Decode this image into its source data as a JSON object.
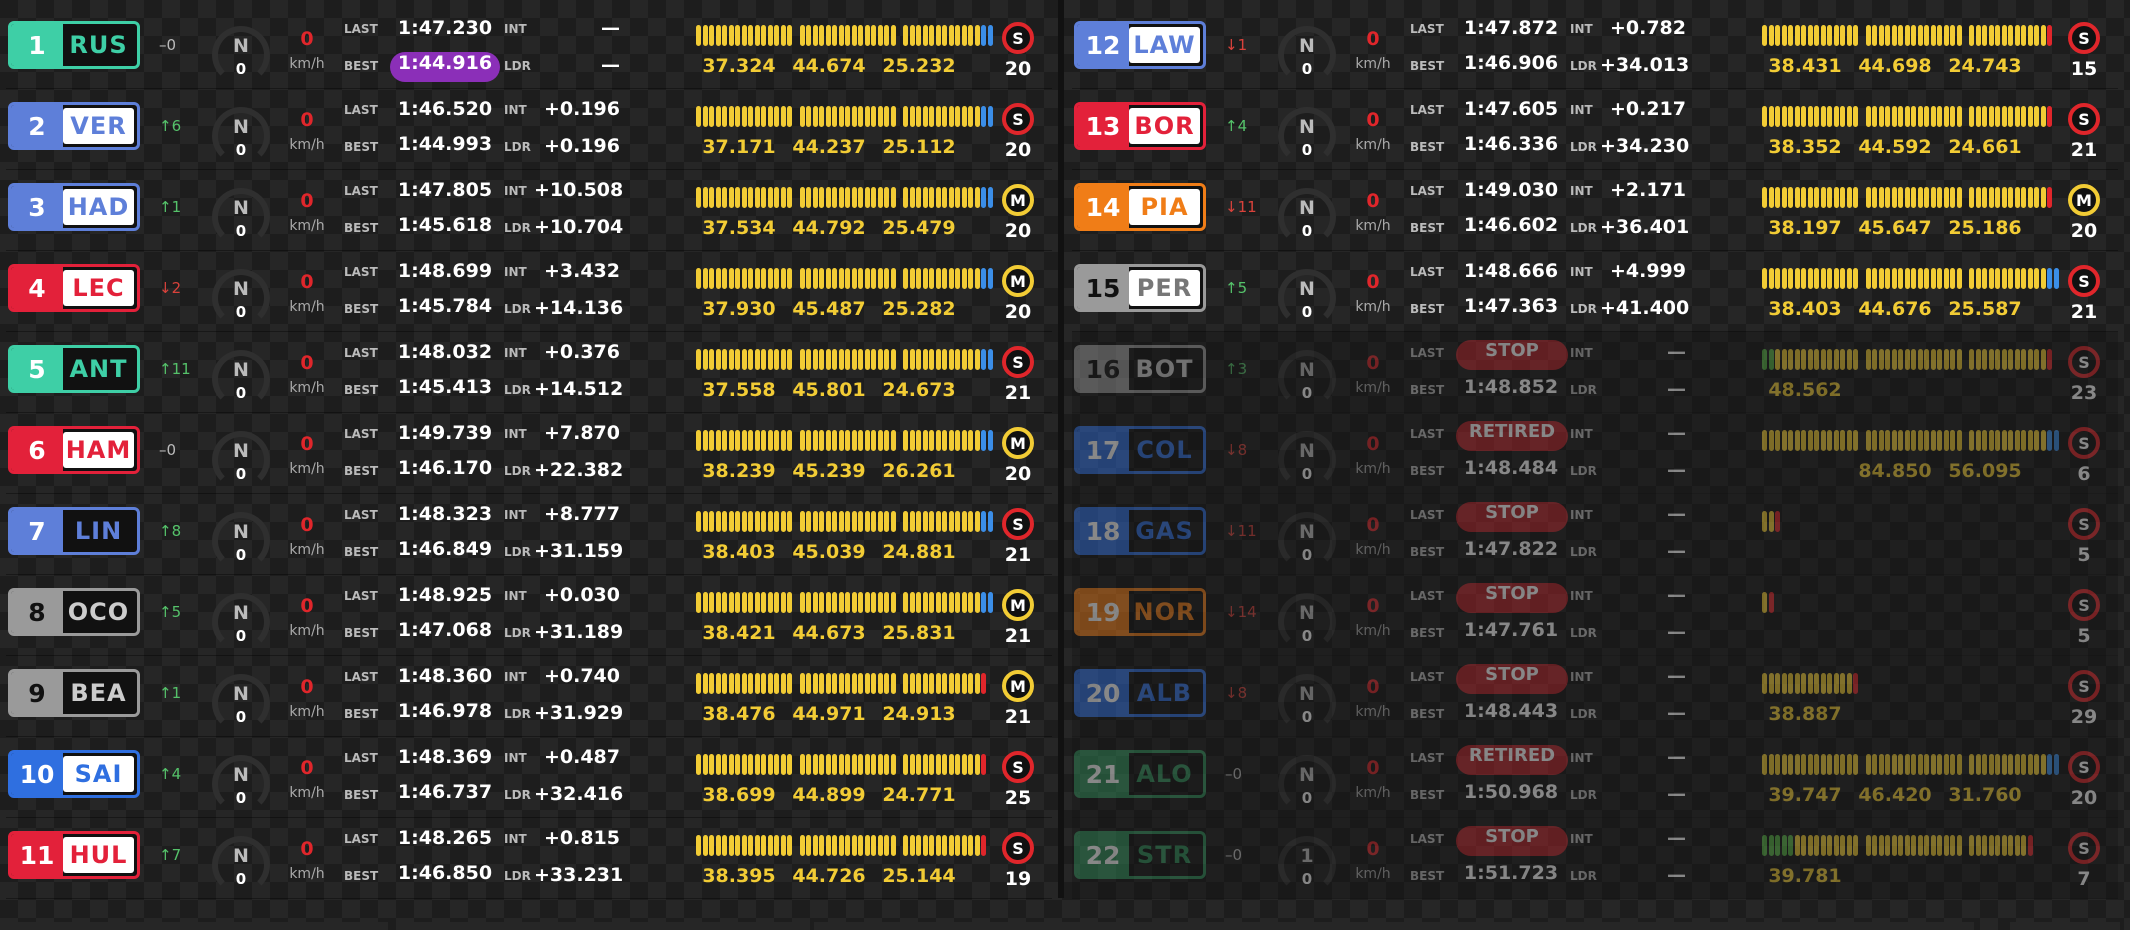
{
  "labels": {
    "last": "LAST",
    "best": "BEST",
    "int": "INT",
    "ldr": "LDR",
    "kmh": "km/h"
  },
  "left": [
    {
      "pos": "1",
      "code": "RUS",
      "color": "#3ecfa6",
      "delta": "–0",
      "dir": "none",
      "gear": "N",
      "gearsub": "0",
      "speed": "0",
      "last": "1:47.230",
      "best": "1:44.916",
      "fastest": true,
      "int": "—",
      "ldr": "—",
      "sectors": [
        "37.324",
        "44.674",
        "25.232"
      ],
      "bar": "yyyyyyyyyyyyyyyyyyyyyyyyyyyyyyyyyyyyyyyyyybb",
      "tyre": "S",
      "laps": "20"
    },
    {
      "pos": "2",
      "code": "VER",
      "color": "#5e7fd9",
      "delta": "6",
      "dir": "up",
      "gear": "N",
      "gearsub": "0",
      "speed": "0",
      "last": "1:46.520",
      "best": "1:44.993",
      "int": "+0.196",
      "ldr": "+0.196",
      "sectors": [
        "37.171",
        "44.237",
        "25.112"
      ],
      "bar": "yyyyyyyyyyyyyyyyyyyyyyyyyyyyyyyyyyyyyyyyyybb",
      "tyre": "S",
      "laps": "20"
    },
    {
      "pos": "3",
      "code": "HAD",
      "color": "#5e7fd9",
      "delta": "1",
      "dir": "up",
      "gear": "N",
      "gearsub": "0",
      "speed": "0",
      "last": "1:47.805",
      "best": "1:45.618",
      "int": "+10.508",
      "ldr": "+10.704",
      "sectors": [
        "37.534",
        "44.792",
        "25.479"
      ],
      "bar": "yyyyyyyyyyyyyyyyyyyyyyyyyyyyyyyyyyyyyyyyyybb",
      "tyre": "M",
      "laps": "20"
    },
    {
      "pos": "4",
      "code": "LEC",
      "color": "#e3213a",
      "delta": "2",
      "dir": "down",
      "gear": "N",
      "gearsub": "0",
      "speed": "0",
      "last": "1:48.699",
      "best": "1:45.784",
      "int": "+3.432",
      "ldr": "+14.136",
      "sectors": [
        "37.930",
        "45.487",
        "25.282"
      ],
      "bar": "yyyyyyyyyyyyyyyyyyyyyyyyyyyyyyyyyyyyyyyyyybb",
      "tyre": "M",
      "laps": "20"
    },
    {
      "pos": "5",
      "code": "ANT",
      "color": "#3ecfa6",
      "delta": "11",
      "dir": "up",
      "gear": "N",
      "gearsub": "0",
      "speed": "0",
      "last": "1:48.032",
      "best": "1:45.413",
      "int": "+0.376",
      "ldr": "+14.512",
      "sectors": [
        "37.558",
        "45.801",
        "24.673"
      ],
      "bar": "yyyyyyyyyyyyyyyyyyyyyyyyyyyyyyyyyyyyyyyyyybb",
      "tyre": "S",
      "laps": "21"
    },
    {
      "pos": "6",
      "code": "HAM",
      "color": "#e3213a",
      "delta": "–0",
      "dir": "none",
      "gear": "N",
      "gearsub": "0",
      "speed": "0",
      "last": "1:49.739",
      "best": "1:46.170",
      "int": "+7.870",
      "ldr": "+22.382",
      "sectors": [
        "38.239",
        "45.239",
        "26.261"
      ],
      "bar": "yyyyyyyyyyyyyyyyyyyyyyyyyyyyyyyyyyyyyyyyyybb",
      "tyre": "M",
      "laps": "20"
    },
    {
      "pos": "7",
      "code": "LIN",
      "color": "#5e7fd9",
      "delta": "8",
      "dir": "up",
      "gear": "N",
      "gearsub": "0",
      "speed": "0",
      "last": "1:48.323",
      "best": "1:46.849",
      "int": "+8.777",
      "ldr": "+31.159",
      "sectors": [
        "38.403",
        "45.039",
        "24.881"
      ],
      "bar": "yyyyyyyyyyyyyyyyyyyyyyyyyyyyyyyyyyyyyyyyyybb",
      "tyre": "S",
      "laps": "21"
    },
    {
      "pos": "8",
      "code": "OCO",
      "color": "#9a9a9a",
      "delta": "5",
      "dir": "up",
      "gear": "N",
      "gearsub": "0",
      "speed": "0",
      "last": "1:48.925",
      "best": "1:47.068",
      "int": "+0.030",
      "ldr": "+31.189",
      "sectors": [
        "38.421",
        "44.673",
        "25.831"
      ],
      "bar": "yyyyyyyyyyyyyyyyyyyyyyyyyyyyyyyyyyyyyyyyyybb",
      "tyre": "M",
      "laps": "21"
    },
    {
      "pos": "9",
      "code": "BEA",
      "color": "#9a9a9a",
      "delta": "1",
      "dir": "up",
      "gear": "N",
      "gearsub": "0",
      "speed": "0",
      "last": "1:48.360",
      "best": "1:46.978",
      "int": "+0.740",
      "ldr": "+31.929",
      "sectors": [
        "38.476",
        "44.971",
        "24.913"
      ],
      "bar": "yyyyyyyyyyyyyyyyyyyyyyyyyyyyyyyyyyyyyyyyyyr",
      "tyre": "M",
      "laps": "21"
    },
    {
      "pos": "10",
      "code": "SAI",
      "color": "#2f6fe0",
      "delta": "4",
      "dir": "up",
      "gear": "N",
      "gearsub": "0",
      "speed": "0",
      "last": "1:48.369",
      "best": "1:46.737",
      "int": "+0.487",
      "ldr": "+32.416",
      "sectors": [
        "38.699",
        "44.899",
        "24.771"
      ],
      "bar": "yyyyyyyyyyyyyyyyyyyyyyyyyyyyyyyyyyyyyyyyyyr",
      "tyre": "S",
      "laps": "25"
    },
    {
      "pos": "11",
      "code": "HUL",
      "color": "#e3213a",
      "delta": "7",
      "dir": "up",
      "gear": "N",
      "gearsub": "0",
      "speed": "0",
      "last": "1:48.265",
      "best": "1:46.850",
      "int": "+0.815",
      "ldr": "+33.231",
      "sectors": [
        "38.395",
        "44.726",
        "25.144"
      ],
      "bar": "yyyyyyyyyyyyyyyyyyyyyyyyyyyyyyyyyyyyyyyyyyr",
      "tyre": "S",
      "laps": "19"
    }
  ],
  "right": [
    {
      "pos": "12",
      "code": "LAW",
      "color": "#5e7fd9",
      "delta": "1",
      "dir": "down",
      "gear": "N",
      "gearsub": "0",
      "speed": "0",
      "last": "1:47.872",
      "best": "1:46.906",
      "int": "+0.782",
      "ldr": "+34.013",
      "sectors": [
        "38.431",
        "44.698",
        "24.743"
      ],
      "bar": "yyyyyyyyyyyyyyyyyyyyyyyyyyyyyyyyyyyyyyyyyyr",
      "tyre": "S",
      "laps": "15"
    },
    {
      "pos": "13",
      "code": "BOR",
      "color": "#e3213a",
      "delta": "4",
      "dir": "up",
      "gear": "N",
      "gearsub": "0",
      "speed": "0",
      "last": "1:47.605",
      "best": "1:46.336",
      "int": "+0.217",
      "ldr": "+34.230",
      "sectors": [
        "38.352",
        "44.592",
        "24.661"
      ],
      "bar": "yyyyyyyyyyyyyyyyyyyyyyyyyyyyyyyyyyyyyyyyyyr",
      "tyre": "S",
      "laps": "21"
    },
    {
      "pos": "14",
      "code": "PIA",
      "color": "#f07d17",
      "delta": "11",
      "dir": "down",
      "gear": "N",
      "gearsub": "0",
      "speed": "0",
      "last": "1:49.030",
      "best": "1:46.602",
      "int": "+2.171",
      "ldr": "+36.401",
      "sectors": [
        "38.197",
        "45.647",
        "25.186"
      ],
      "bar": "yyyyyyyyyyyyyyyyyyyyyyyyyyyyyyyyyyyyyyyyyyr",
      "tyre": "M",
      "laps": "20"
    },
    {
      "pos": "15",
      "code": "PER",
      "color": "#9a9a9a",
      "delta": "5",
      "dir": "up",
      "gear": "N",
      "gearsub": "0",
      "speed": "0",
      "last": "1:48.666",
      "best": "1:47.363",
      "int": "+4.999",
      "ldr": "+41.400",
      "sectors": [
        "38.403",
        "44.676",
        "25.587"
      ],
      "bar": "yyyyyyyyyyyyyyyyyyyyyyyyyyyyyyyyyyyyyyyyyybb",
      "tyre": "S",
      "laps": "21"
    },
    {
      "pos": "16",
      "code": "BOT",
      "color": "#9a9a9a",
      "dim": true,
      "delta": "3",
      "dir": "up",
      "gear": "N",
      "gearsub": "0",
      "speed": "0",
      "status": "STOP",
      "best": "1:48.852",
      "int": "—",
      "ldr": "—",
      "sectors": [
        "48.562",
        "",
        ""
      ],
      "bar": "ggyyyyyyyyyyyyyyyyyyyyyyyyyyyyyyyyyyyyyyyyr",
      "tyre": "S",
      "laps": "23"
    },
    {
      "pos": "17",
      "code": "COL",
      "color": "#2f6fe0",
      "dim": true,
      "delta": "8",
      "dir": "down",
      "gear": "N",
      "gearsub": "0",
      "speed": "0",
      "status": "RETIRED",
      "best": "1:48.484",
      "int": "—",
      "ldr": "—",
      "sectors": [
        "",
        "84.850",
        "56.095"
      ],
      "bar": "yyyyyyyyyyyyyyyyyyyyyyyyyyyyyyyyyyyyyyyyyybb",
      "tyre": "S",
      "laps": "6"
    },
    {
      "pos": "18",
      "code": "GAS",
      "color": "#2f6fe0",
      "dim": true,
      "delta": "11",
      "dir": "down",
      "gear": "N",
      "gearsub": "0",
      "speed": "0",
      "status": "STOP",
      "best": "1:47.822",
      "int": "—",
      "ldr": "—",
      "sectors": [
        "",
        "",
        ""
      ],
      "bar": "yyr",
      "tyre": "S",
      "laps": "5"
    },
    {
      "pos": "19",
      "code": "NOR",
      "color": "#f07d17",
      "dim": true,
      "delta": "14",
      "dir": "down",
      "gear": "N",
      "gearsub": "0",
      "speed": "0",
      "status": "STOP",
      "best": "1:47.761",
      "int": "—",
      "ldr": "—",
      "sectors": [
        "",
        "",
        ""
      ],
      "bar": "yr",
      "tyre": "S",
      "laps": "5"
    },
    {
      "pos": "20",
      "code": "ALB",
      "color": "#2f6fe0",
      "dim": true,
      "delta": "8",
      "dir": "down",
      "gear": "N",
      "gearsub": "0",
      "speed": "0",
      "status": "STOP",
      "best": "1:48.443",
      "int": "—",
      "ldr": "—",
      "sectors": [
        "38.887",
        "",
        ""
      ],
      "bar": "yyyyyyyyyyyyyyr",
      "tyre": "S",
      "laps": "29"
    },
    {
      "pos": "21",
      "code": "ALO",
      "color": "#2f8f5a",
      "dim": true,
      "delta": "–0",
      "dir": "none",
      "gear": "N",
      "gearsub": "0",
      "speed": "0",
      "status": "RETIRED",
      "best": "1:50.968",
      "int": "—",
      "ldr": "—",
      "sectors": [
        "39.747",
        "46.420",
        "31.760"
      ],
      "bar": "yyyyyyyyyyyyyyyyyyyyyyyyyyyyyyyyyyyyyyyyyybb",
      "tyre": "S",
      "laps": "20"
    },
    {
      "pos": "22",
      "code": "STR",
      "color": "#2f8f5a",
      "dim": true,
      "delta": "–0",
      "dir": "none",
      "gear": "1",
      "gearsub": "0",
      "speed": "0",
      "status": "STOP",
      "best": "1:51.723",
      "int": "—",
      "ldr": "—",
      "sectors": [
        "39.781",
        "",
        ""
      ],
      "bar": "gggggyyyyyyyyyyyyyyyyyyyyyyyyyyyyyyyyyyr",
      "tyre": "S",
      "laps": "7"
    }
  ]
}
